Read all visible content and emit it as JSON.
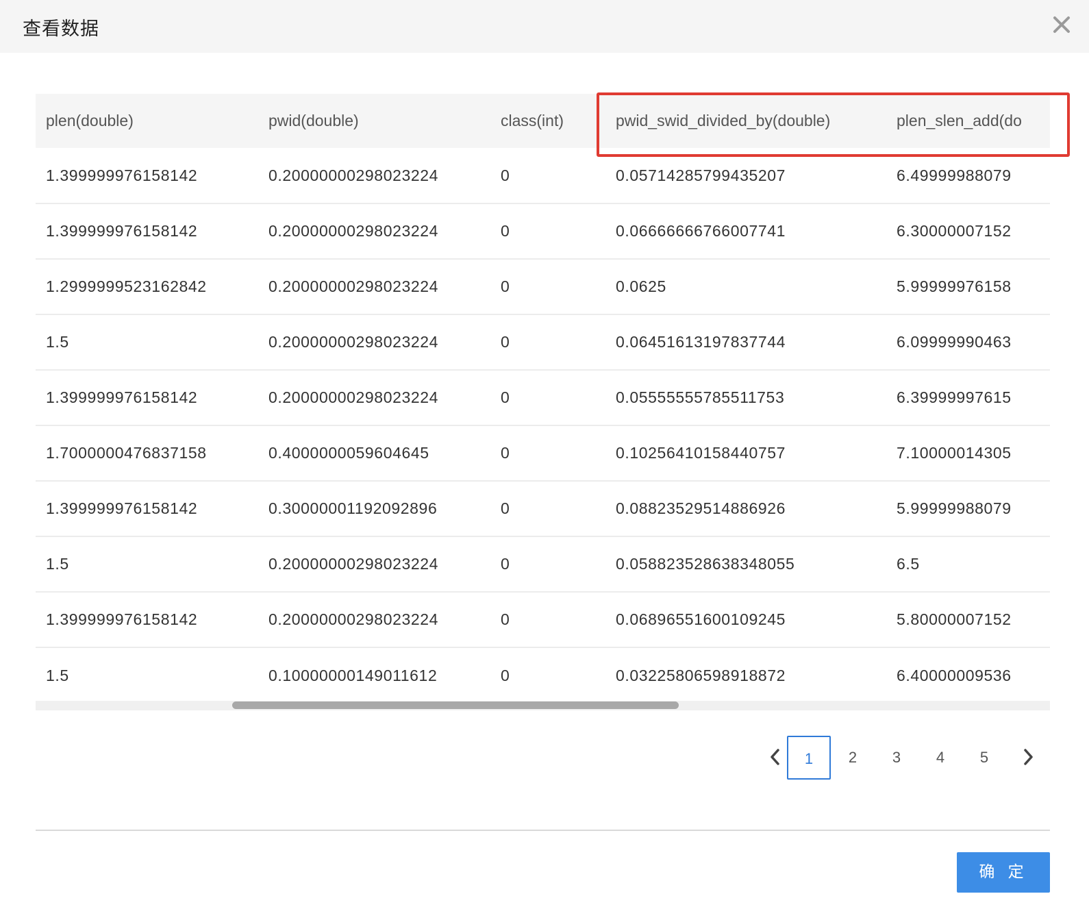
{
  "dialog": {
    "title": "查看数据",
    "close_icon": "close-icon"
  },
  "table": {
    "columns": [
      "plen(double)",
      "pwid(double)",
      "class(int)",
      "pwid_swid_divided_by(double)",
      "plen_slen_add(do"
    ],
    "rows": [
      [
        "1.399999976158142",
        "0.20000000298023224",
        "0",
        "0.05714285799435207",
        "6.49999988079"
      ],
      [
        "1.399999976158142",
        "0.20000000298023224",
        "0",
        "0.06666666766007741",
        "6.30000007152"
      ],
      [
        "1.2999999523162842",
        "0.20000000298023224",
        "0",
        "0.0625",
        "5.99999976158"
      ],
      [
        "1.5",
        "0.20000000298023224",
        "0",
        "0.06451613197837744",
        "6.09999990463"
      ],
      [
        "1.399999976158142",
        "0.20000000298023224",
        "0",
        "0.05555555785511753",
        "6.39999997615"
      ],
      [
        "1.7000000476837158",
        "0.4000000059604645",
        "0",
        "0.10256410158440757",
        "7.10000014305"
      ],
      [
        "1.399999976158142",
        "0.30000001192092896",
        "0",
        "0.08823529514886926",
        "5.99999988079"
      ],
      [
        "1.5",
        "0.20000000298023224",
        "0",
        "0.058823528638348055",
        "6.5"
      ],
      [
        "1.399999976158142",
        "0.20000000298023224",
        "0",
        "0.06896551600109245",
        "5.80000007152"
      ],
      [
        "1.5",
        "0.10000000149011612",
        "0",
        "0.03225806598918872",
        "6.40000009536"
      ]
    ]
  },
  "pagination": {
    "pages": [
      "1",
      "2",
      "3",
      "4",
      "5"
    ],
    "current": "1",
    "prev_icon": "chevron-left-icon",
    "next_icon": "chevron-right-icon"
  },
  "footer": {
    "confirm_label": "确 定"
  },
  "colors": {
    "accent": "#3d8de6",
    "highlight": "#e03b32",
    "header_bg": "#f5f5f5"
  }
}
